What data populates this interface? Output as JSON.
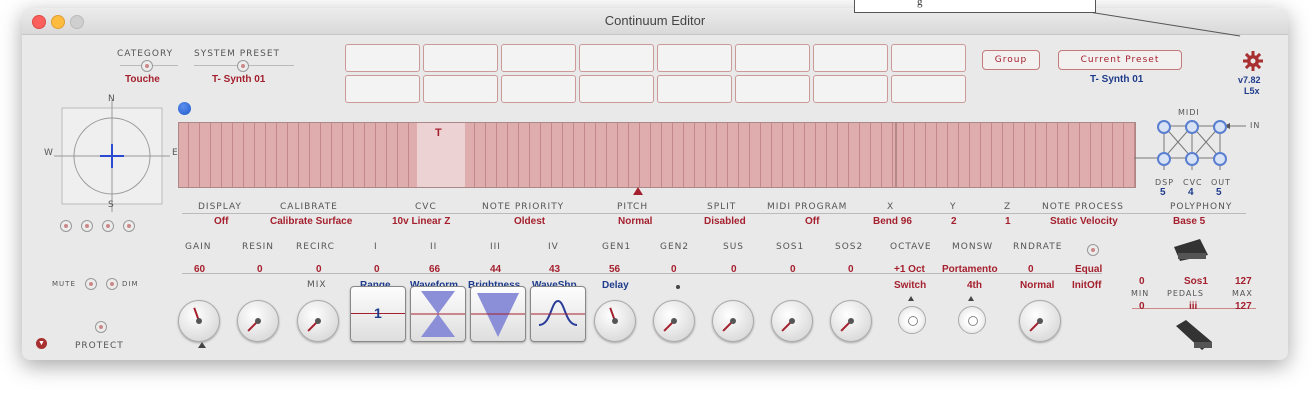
{
  "window": {
    "title": "Continuum Editor"
  },
  "tooltip": {
    "text": "g"
  },
  "header": {
    "category": {
      "label": "Category",
      "value": "Touche"
    },
    "system_preset": {
      "label": "System Preset",
      "value": "T- Synth 01"
    },
    "group_button": "Group",
    "current_preset_button": "Current Preset",
    "current_preset_value": "T- Synth 01",
    "version": "v7.82",
    "model": "L5x"
  },
  "compass": {
    "n": "N",
    "s": "S",
    "w": "W",
    "e": "E"
  },
  "strip": {
    "marker": "T"
  },
  "midi_matrix": {
    "title": "MIDI",
    "in_label": "IN",
    "outs": [
      {
        "label": "DSP",
        "value": "5"
      },
      {
        "label": "CVC",
        "value": "4"
      },
      {
        "label": "OUT",
        "value": "5"
      }
    ]
  },
  "params": [
    {
      "label": "Display",
      "value": "Off"
    },
    {
      "label": "Calibrate",
      "value": "Calibrate Surface"
    },
    {
      "label": "Cvc",
      "value": "10v Linear Z"
    },
    {
      "label": "Note Priority",
      "value": "Oldest"
    },
    {
      "label": "Pitch",
      "value": "Normal"
    },
    {
      "label": "Split",
      "value": "Disabled"
    },
    {
      "label": "Midi Program",
      "value": "Off"
    },
    {
      "label": "X",
      "value": "Bend 96"
    },
    {
      "label": "Y",
      "value": "2"
    },
    {
      "label": "Z",
      "value": "1"
    },
    {
      "label": "Note Process",
      "value": "Static Velocity"
    },
    {
      "label": "Polyphony",
      "value": "Base 5"
    }
  ],
  "left_controls": {
    "mute": "Mute",
    "dim": "Dim",
    "protect": "Protect"
  },
  "controls": [
    {
      "label": "Gain",
      "value": "60"
    },
    {
      "label": "ResIn",
      "value": "0"
    },
    {
      "label": "RecirC",
      "value": "0"
    },
    {
      "label": "i",
      "value": "0"
    },
    {
      "label": "ii",
      "value": "66"
    },
    {
      "label": "iii",
      "value": "44"
    },
    {
      "label": "iv",
      "value": "43"
    },
    {
      "label": "Gen1",
      "value": "56"
    },
    {
      "label": "Gen2",
      "value": "0"
    },
    {
      "label": "Sus",
      "value": "0"
    },
    {
      "label": "Sos1",
      "value": "0"
    },
    {
      "label": "Sos2",
      "value": "0"
    },
    {
      "label": "Octave",
      "value": "+1 Oct"
    },
    {
      "label": "MonSw",
      "value": "Portamento"
    },
    {
      "label": "RndRate",
      "value": "0"
    },
    {
      "label": "",
      "value": "Equal"
    }
  ],
  "sublabels": {
    "mix": "Mix",
    "range": "Range",
    "waveform": "Waveform",
    "brightness": "Brightness",
    "waveshp": "WaveShp",
    "delay": "Delay",
    "switch": "Switch",
    "fourth": "4th",
    "normal": "Normal",
    "initoff": "InitOff",
    "range_value": "1"
  },
  "pedals": {
    "p1_min": "0",
    "p1_name": "Sos1",
    "p1_max": "127",
    "min_label": "Min",
    "title": "Pedals",
    "max_label": "Max",
    "p2_min": "0",
    "p2_name": "iii",
    "p2_max": "127"
  }
}
